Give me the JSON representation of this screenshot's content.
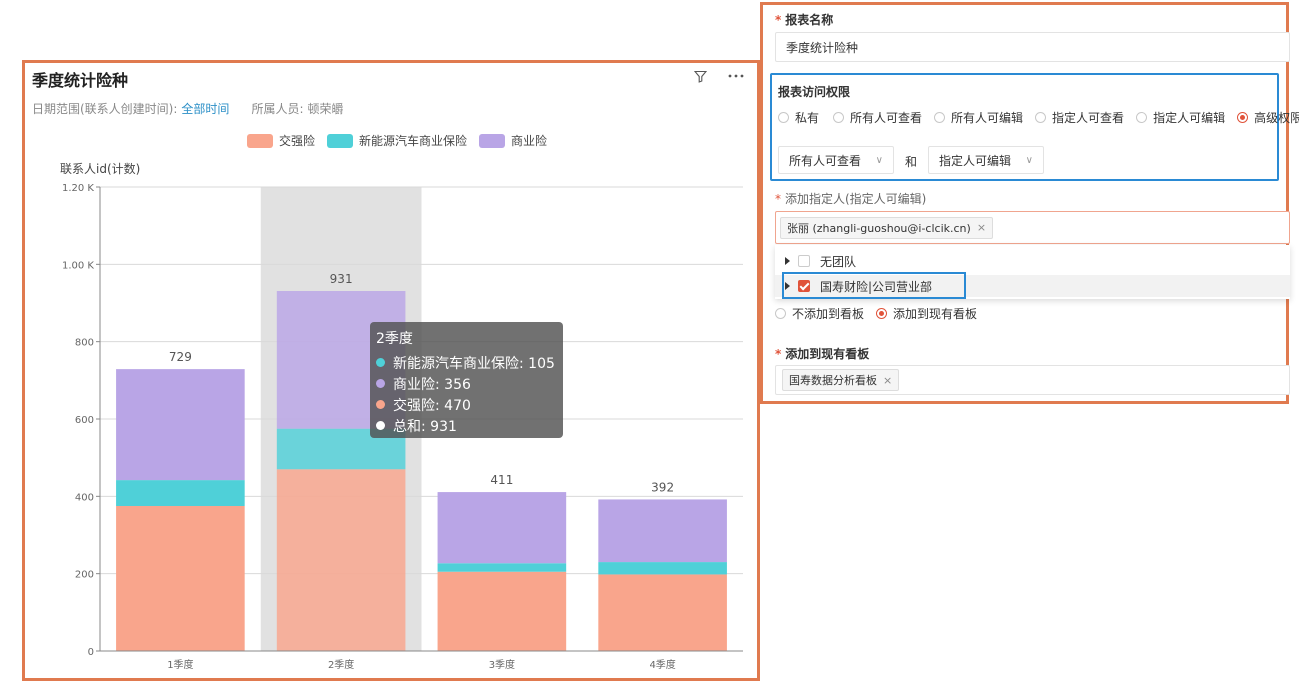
{
  "chart_panel": {
    "title": "季度统计险种",
    "filter_label": "日期范围(联系人创建时间):",
    "filter_value": "全部时间",
    "owner_label": "所属人员:",
    "owner_value": "顿荣皭",
    "tooltip": {
      "title": "2季度",
      "rows": [
        {
          "label": "新能源汽车商业保险: 105",
          "color": "#4fd0d8"
        },
        {
          "label": "商业险: 356",
          "color": "#b9a5e6"
        },
        {
          "label": "交强险: 470",
          "color": "#f9a58c"
        },
        {
          "label": "总和: 931",
          "color": "#ffffff"
        }
      ]
    }
  },
  "chart_data": {
    "type": "bar",
    "stacked": true,
    "categories": [
      "1季度",
      "2季度",
      "3季度",
      "4季度"
    ],
    "series": [
      {
        "name": "交强险",
        "color": "#f9a58c",
        "values": [
          375,
          470,
          205,
          198
        ]
      },
      {
        "name": "新能源汽车商业保险",
        "color": "#4fd0d8",
        "values": [
          67,
          105,
          22,
          32
        ]
      },
      {
        "name": "商业险",
        "color": "#b9a5e6",
        "values": [
          287,
          356,
          184,
          162
        ]
      }
    ],
    "totals": [
      729,
      931,
      411,
      392
    ],
    "ylabel": "联系人id(计数)",
    "ylim": [
      0,
      1200
    ],
    "yticks": [
      0,
      200,
      400,
      600,
      800,
      1000,
      1200
    ],
    "ytick_labels": [
      "0",
      "200",
      "400",
      "600",
      "800",
      "1.00 K",
      "1.20 K"
    ],
    "highlighted_category": "2季度",
    "legend_position": "top",
    "grid": true
  },
  "form": {
    "report_name_label": "报表名称",
    "report_name_value": "季度统计险种",
    "access_label": "报表访问权限",
    "access_options": [
      {
        "label": "私有",
        "checked": false
      },
      {
        "label": "所有人可查看",
        "checked": false
      },
      {
        "label": "所有人可编辑",
        "checked": false
      },
      {
        "label": "指定人可查看",
        "checked": false
      },
      {
        "label": "指定人可编辑",
        "checked": false
      },
      {
        "label": "高级权限",
        "checked": true
      }
    ],
    "select_view": "所有人可查看",
    "and_text": "和",
    "select_edit": "指定人可编辑",
    "add_person_label": "添加指定人(指定人可编辑)",
    "person_tag": "张丽 (zhangli-guoshou@i-clcik.cn)",
    "tree_items": [
      {
        "label": "无团队",
        "checked": false
      },
      {
        "label": "国寿财险|公司营业部",
        "checked": true
      }
    ],
    "dashboard_options": [
      {
        "label": "不添加到看板",
        "checked": false
      },
      {
        "label": "添加到现有看板",
        "checked": true
      }
    ],
    "existing_board_label": "添加到现有看板",
    "board_tag": "国寿数据分析看板"
  }
}
